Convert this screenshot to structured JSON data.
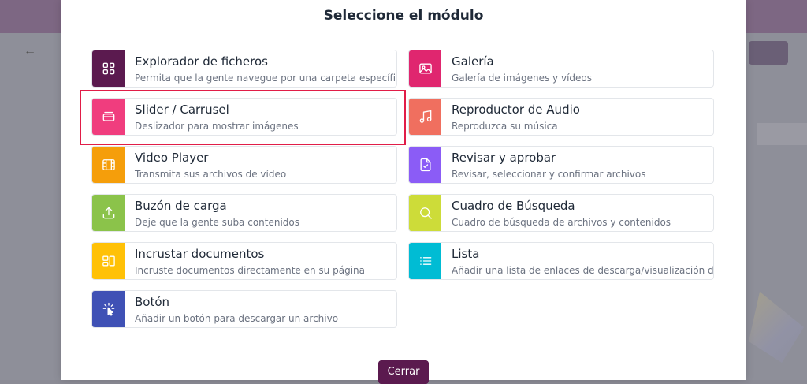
{
  "modal": {
    "title": "Seleccione el módulo",
    "close_label": "Cerrar"
  },
  "colors": {
    "accent": "#5b1a4f",
    "highlight": "#e11d48"
  },
  "modules": [
    {
      "title": "Explorador de ficheros",
      "desc": "Permita que la gente navegue por una carpeta específica",
      "icon": "grid-icon",
      "color": "#5b1a4f"
    },
    {
      "title": "Galería",
      "desc": "Galería de imágenes y vídeos",
      "icon": "image-icon",
      "color": "#e0266f"
    },
    {
      "title": "Slider / Carrusel",
      "desc": "Deslizador para mostrar imágenes",
      "icon": "slides-icon",
      "color": "#f03d7e"
    },
    {
      "title": "Reproductor de Audio",
      "desc": "Reproduzca su música",
      "icon": "music-icon",
      "color": "#f06f5f"
    },
    {
      "title": "Video Player",
      "desc": "Transmita sus archivos de vídeo",
      "icon": "film-icon",
      "color": "#f59e0b"
    },
    {
      "title": "Revisar y aprobar",
      "desc": "Revisar, seleccionar y confirmar archivos",
      "icon": "file-check-icon",
      "color": "#8b5cf6"
    },
    {
      "title": "Buzón de carga",
      "desc": "Deje que la gente suba contenidos",
      "icon": "upload-icon",
      "color": "#8bc34a"
    },
    {
      "title": "Cuadro de Búsqueda",
      "desc": "Cuadro de búsqueda de archivos y contenidos",
      "icon": "search-icon",
      "color": "#cddc39"
    },
    {
      "title": "Incrustar documentos",
      "desc": "Incruste documentos directamente en su página",
      "icon": "embed-icon",
      "color": "#ffc107"
    },
    {
      "title": "Lista",
      "desc": "Añadir una lista de enlaces de descarga/visualización de ar",
      "icon": "list-icon",
      "color": "#00bcd4"
    },
    {
      "title": "Botón",
      "desc": "Añadir un botón para descargar un archivo",
      "icon": "pointer-click-icon",
      "color": "#3f51b5"
    }
  ]
}
